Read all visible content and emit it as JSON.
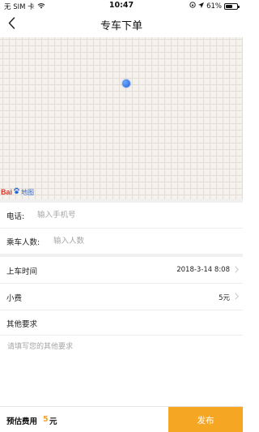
{
  "status_bar": {
    "carrier": "无 SIM 卡",
    "time": "10:47",
    "battery": "61%",
    "battery_level": 0.61
  },
  "nav": {
    "title": "专车下单"
  },
  "map": {
    "logo_text": "Bai",
    "logo_suffix": "地图"
  },
  "form": {
    "phone": {
      "label": "电话:",
      "placeholder": "输入手机号"
    },
    "passengers": {
      "label": "乘车人数:",
      "placeholder": "输入人数"
    },
    "pickup_time": {
      "label": "上车时间",
      "value": "2018-3-14 8:08"
    },
    "tip": {
      "label": "小费",
      "value": "5元"
    },
    "other_requirements": {
      "label": "其他要求",
      "placeholder": "请填写您的其他要求"
    }
  },
  "footer": {
    "fee_prefix": "预估费用",
    "fee_amount": "5",
    "fee_unit": "元",
    "publish_label": "发布"
  },
  "colors": {
    "accent": "#f5a623",
    "fee_highlight": "#f0a22e",
    "location_dot": "#1e5fd6"
  }
}
